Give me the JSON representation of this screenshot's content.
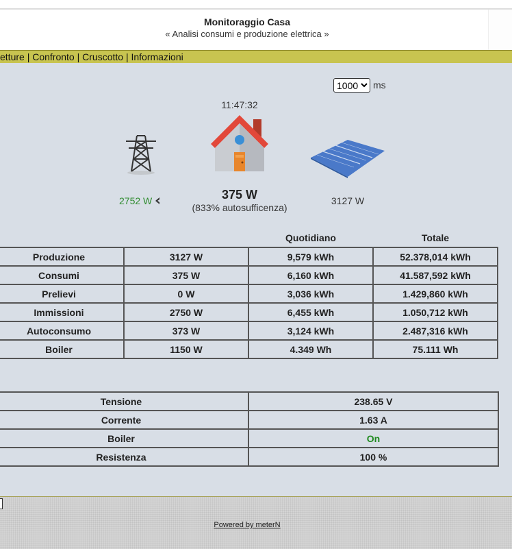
{
  "header": {
    "title": "Monitoraggio Casa",
    "subtitle": "« Analisi consumi e produzione elettrica »"
  },
  "menu": {
    "items": [
      "etture",
      "Confronto",
      "Cruscotto",
      "Informazioni"
    ],
    "separator": " | "
  },
  "refresh": {
    "selected": "1000",
    "unit": "ms"
  },
  "dashboard": {
    "time": "11:47:32",
    "grid_power": "2752 W",
    "house_power": "375 W",
    "autosufficiency": "(833% autosufficenza)",
    "solar_power": "3127 W",
    "icons": [
      "power-tower-icon",
      "house-icon",
      "solar-panel-icon",
      "arrow-left-icon"
    ]
  },
  "energy_table": {
    "headers": [
      "",
      "",
      "Quotidiano",
      "Totale"
    ],
    "rows": [
      [
        "Produzione",
        "3127 W",
        "9,579 kWh",
        "52.378,014 kWh"
      ],
      [
        "Consumi",
        "375 W",
        "6,160 kWh",
        "41.587,592 kWh"
      ],
      [
        "Prelievi",
        "0 W",
        "3,036 kWh",
        "1.429,860 kWh"
      ],
      [
        "Immissioni",
        "2750 W",
        "6,455 kWh",
        "1.050,712 kWh"
      ],
      [
        "Autoconsumo",
        "373 W",
        "3,124 kWh",
        "2.487,316 kWh"
      ],
      [
        "Boiler",
        "1150 W",
        "4.349 Wh",
        "75.111 Wh"
      ]
    ]
  },
  "status_table": {
    "rows": [
      [
        "Tensione",
        "238.65 V"
      ],
      [
        "Corrente",
        "1.63 A"
      ],
      [
        "Boiler",
        "On"
      ],
      [
        "Resistenza",
        "100 %"
      ]
    ]
  },
  "footer": {
    "powered_by": "Powered by meterN"
  },
  "colors": {
    "menu_bar": "#c8c450",
    "main_bg": "#d8dee6",
    "grid_power_text": "#2e8b2e",
    "status_on": "#1f8a1f"
  }
}
